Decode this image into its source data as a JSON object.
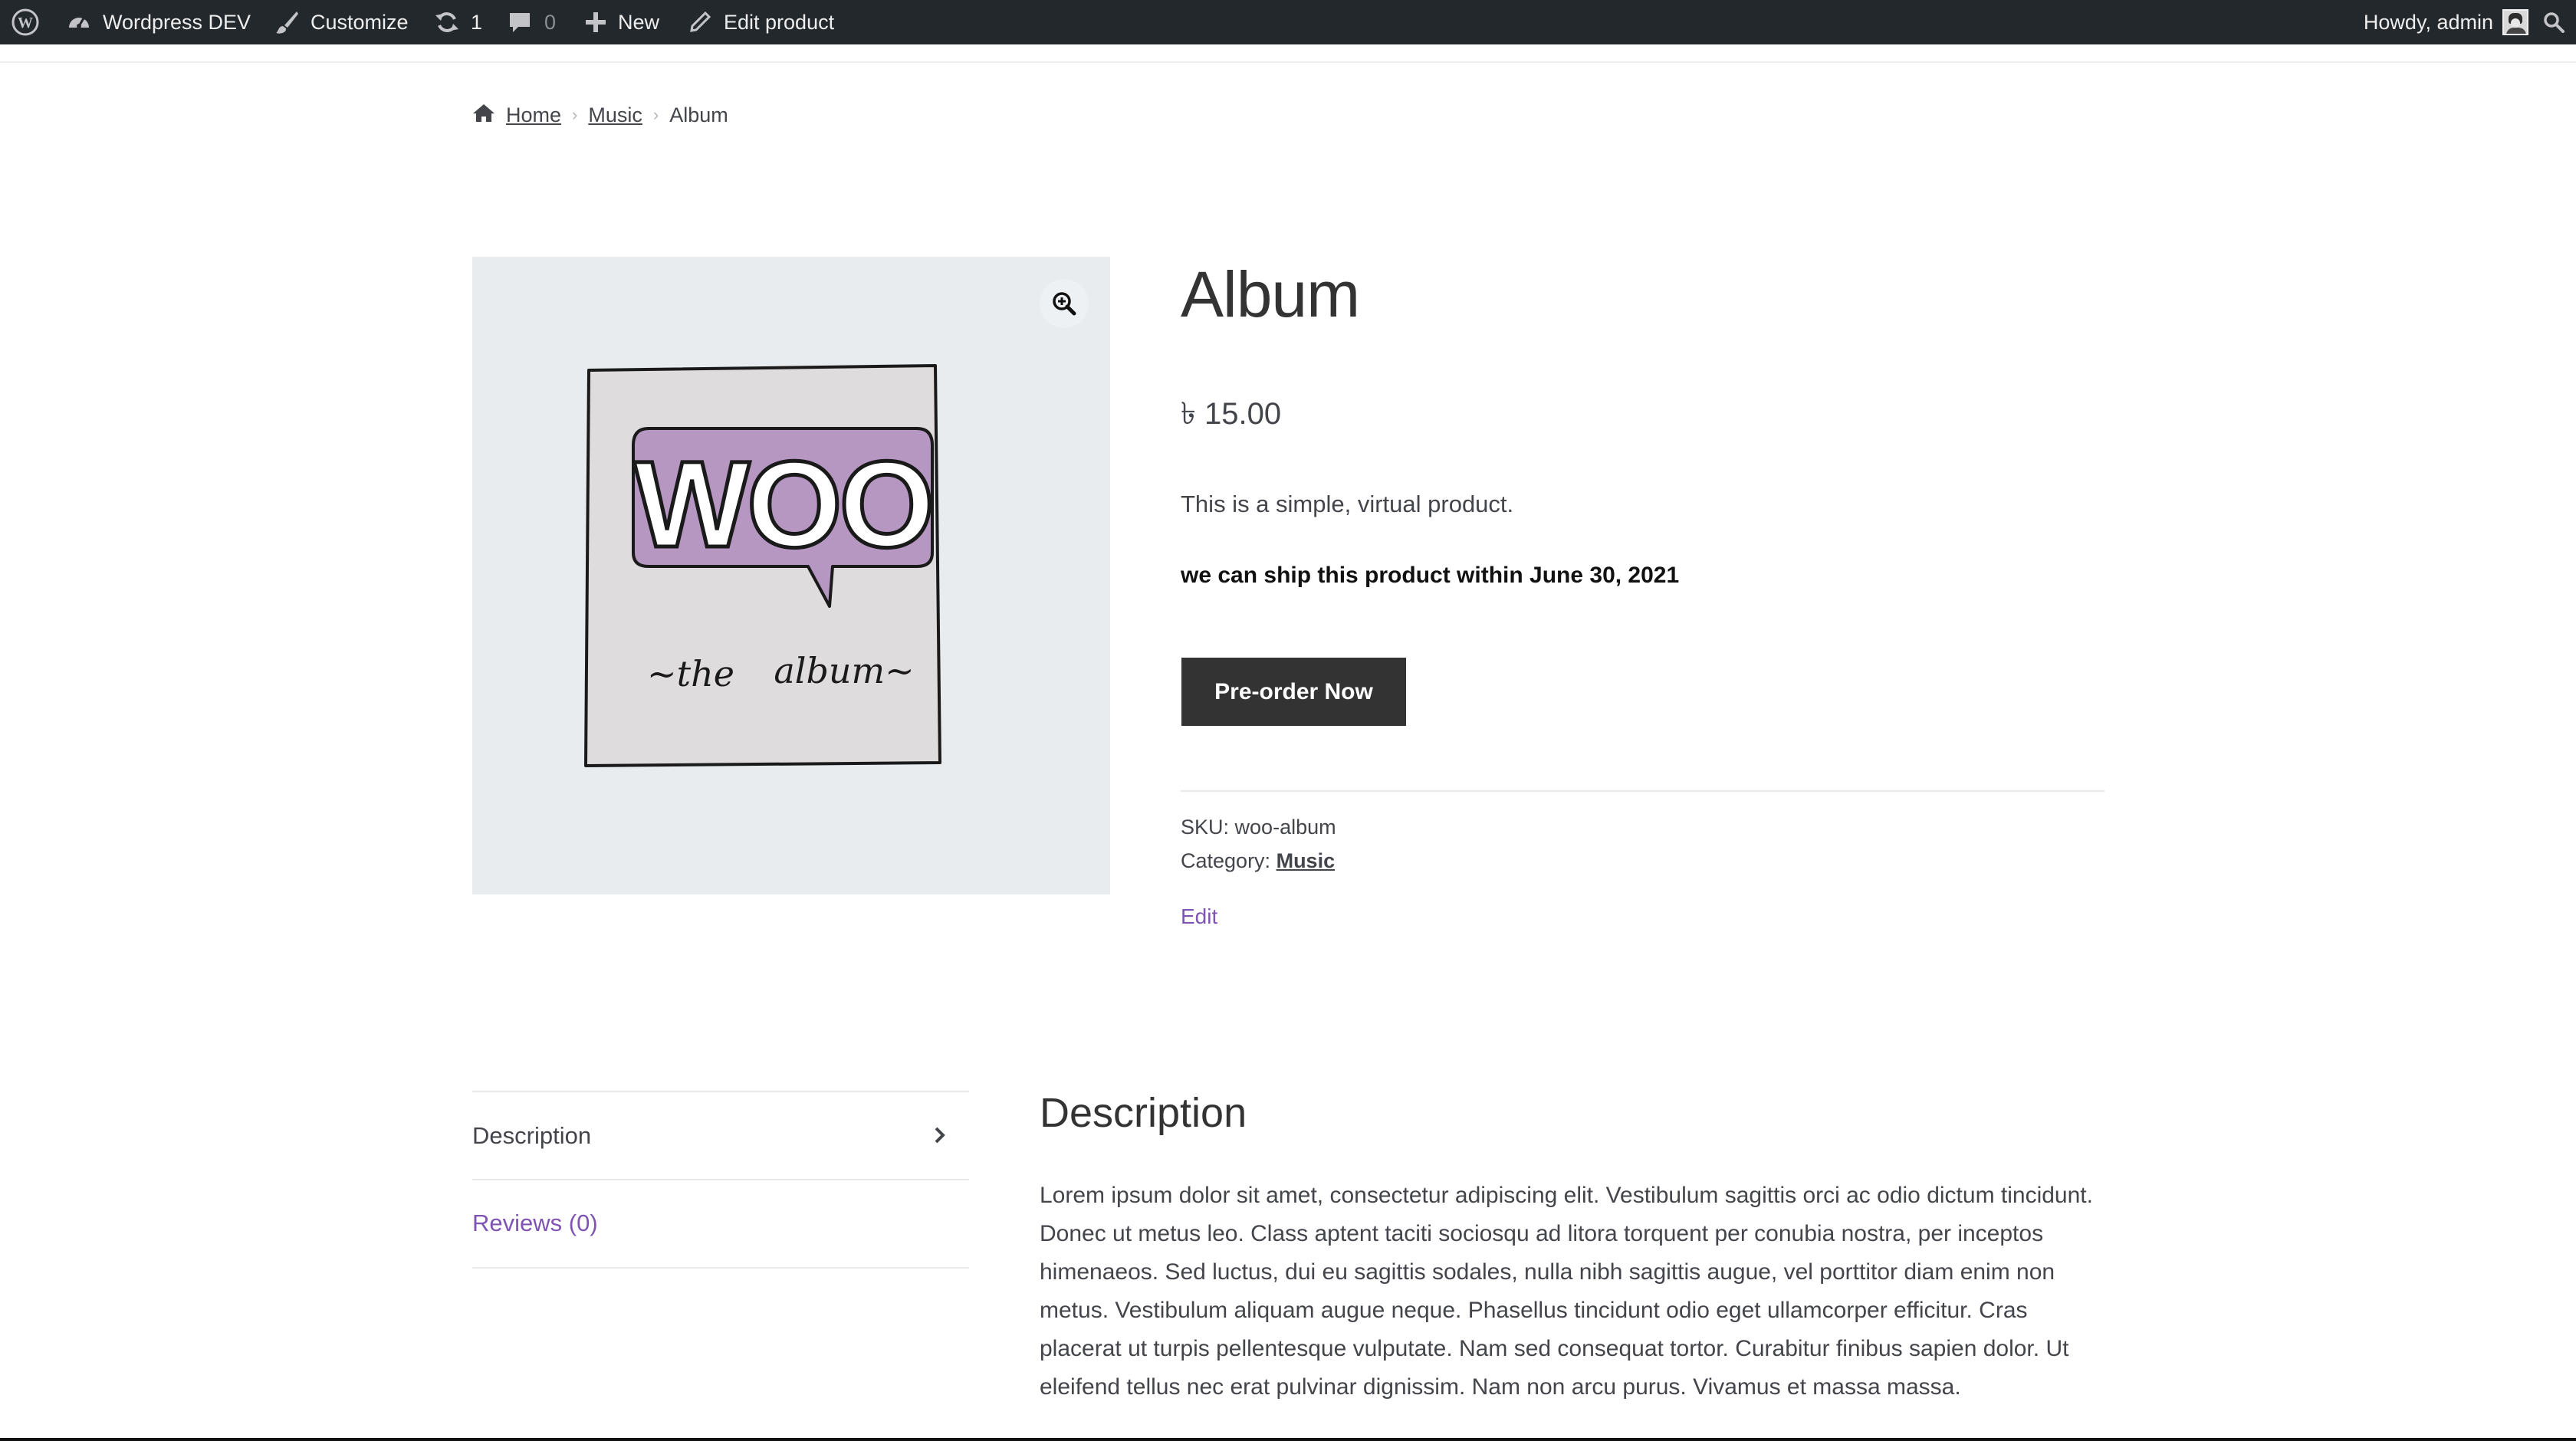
{
  "admin_bar": {
    "site_name": "Wordpress DEV",
    "customize": "Customize",
    "updates_count": "1",
    "comments_count": "0",
    "new": "New",
    "edit_product": "Edit product",
    "howdy": "Howdy, admin"
  },
  "breadcrumb": {
    "home": "Home",
    "category": "Music",
    "current": "Album"
  },
  "product": {
    "title": "Album",
    "price": "৳ 15.00",
    "short_description": "This is a simple, virtual product.",
    "shipping_note": "we can ship this product within June 30, 2021",
    "preorder_button": "Pre-order Now",
    "sku_label": "SKU:",
    "sku_value": "woo-album",
    "category_label": "Category:",
    "category_value": "Music",
    "edit_link": "Edit",
    "image": {
      "badge_text": "WOO",
      "caption_left": "~the",
      "caption_right": "album~"
    }
  },
  "tabs": [
    {
      "label": "Description",
      "active": true
    },
    {
      "label": "Reviews (0)",
      "active": false
    }
  ],
  "description_panel": {
    "title": "Description",
    "body": "Lorem ipsum dolor sit amet, consectetur adipiscing elit. Vestibulum sagittis orci ac odio dictum tincidunt. Donec ut metus leo. Class aptent taciti sociosqu ad litora torquent per conubia nostra, per inceptos himenaeos. Sed luctus, dui eu sagittis sodales, nulla nibh sagittis augue, vel porttitor diam enim non metus. Vestibulum aliquam augue neque. Phasellus tincidunt odio eget ullamcorper efficitur. Cras placerat ut turpis pellentesque vulputate. Nam sed consequat tortor. Curabitur finibus sapien dolor. Ut eleifend tellus nec erat pulvinar dignissim. Nam non arcu purus. Vivamus et massa massa."
  },
  "icons": {
    "wordpress": "wordpress-logo-icon",
    "dashboard": "dashboard-icon",
    "customize": "paintbrush-icon",
    "updates": "refresh-icon",
    "comments": "comment-bubble-icon",
    "new": "plus-icon",
    "edit": "pencil-icon",
    "search": "search-icon",
    "home": "home-icon",
    "zoom": "zoom-in-icon",
    "chevron": "chevron-right-icon"
  },
  "colors": {
    "admin_bar_bg": "#23282d",
    "button_bg": "#333333",
    "link_accent": "#7f54b3",
    "gallery_bg": "#e8ecef",
    "woo_purple": "#b597c2"
  }
}
